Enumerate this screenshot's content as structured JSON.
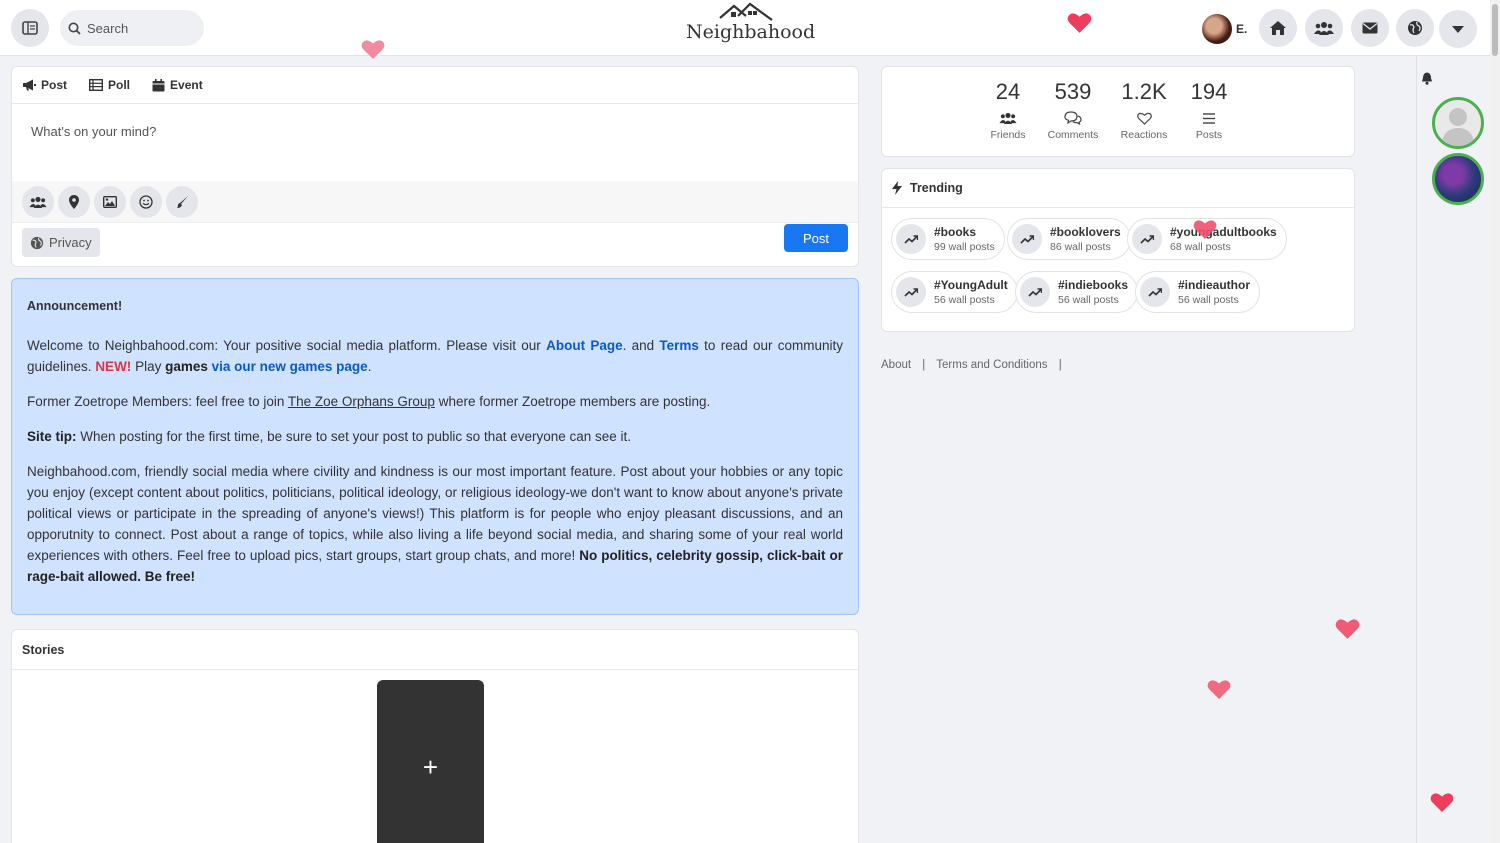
{
  "header": {
    "search_placeholder": "Search",
    "logo_text": "Neighbahood",
    "user_name": "E."
  },
  "composer": {
    "tabs": [
      "Post",
      "Poll",
      "Event"
    ],
    "placeholder": "What's on your mind?",
    "privacy_label": "Privacy",
    "post_label": "Post"
  },
  "announcement": {
    "title": "Announcement!",
    "p1_a": "Welcome to Neighbahood.com: Your positive social media platform. Please visit our ",
    "p1_about": "About Page",
    "p1_b": ". and ",
    "p1_terms": "Terms",
    "p1_c": " to read our community guidelines. ",
    "p1_new": "NEW!",
    "p1_d": " Play ",
    "p1_games": "games",
    "p1_e": " ",
    "p1_via": "via our new games page",
    "p1_f": ".",
    "p2_a": "Former Zoetrope Members: feel free to join ",
    "p2_link": "The Zoe Orphans Group",
    "p2_b": " where former Zoetrope members are posting.",
    "p3_bold": "Site tip:",
    "p3_text": " When posting for the first time, be sure to set your post to public so that everyone can see it.",
    "p4_text": "Neighbahood.com, friendly social media where civility and kindness is our most important feature. Post about your hobbies or any topic you enjoy (except content about politics, politicians, political ideology, or religious ideology-we don't want to know about anyone's private political views or participate in the spreading of anyone's views!) This platform is for people who enjoy pleasant discussions, and an opporutnity to connect. Post about a range of topics, while also living a life beyond social media, and sharing some of your real world experiences with others. Feel free to upload pics, start groups, start group chats, and more! ",
    "p4_bold": "No politics, celebrity gossip, click-bait or rage-bait allowed. Be free!"
  },
  "stories": {
    "title": "Stories",
    "add_label": "+"
  },
  "stats": [
    {
      "value": "24",
      "label": "Friends"
    },
    {
      "value": "539",
      "label": "Comments"
    },
    {
      "value": "1.2K",
      "label": "Reactions"
    },
    {
      "value": "194",
      "label": "Posts"
    }
  ],
  "trending": {
    "title": "Trending",
    "items": [
      {
        "tag": "#books",
        "count": "99 wall posts"
      },
      {
        "tag": "#booklovers",
        "count": "86 wall posts"
      },
      {
        "tag": "#youngadultbooks",
        "count": "68 wall posts"
      },
      {
        "tag": "#YoungAdult",
        "count": "56 wall posts"
      },
      {
        "tag": "#indiebooks",
        "count": "56 wall posts"
      },
      {
        "tag": "#indieauthor",
        "count": "56 wall posts"
      }
    ]
  },
  "footer": {
    "about": "About",
    "sep": "|",
    "terms": "Terms and Conditions"
  },
  "colors": {
    "accent": "#1877f2",
    "announcement_bg": "#cfe2ff",
    "link": "#0a58ca",
    "new_badge": "#dc3545",
    "heart": "#f0506e"
  }
}
